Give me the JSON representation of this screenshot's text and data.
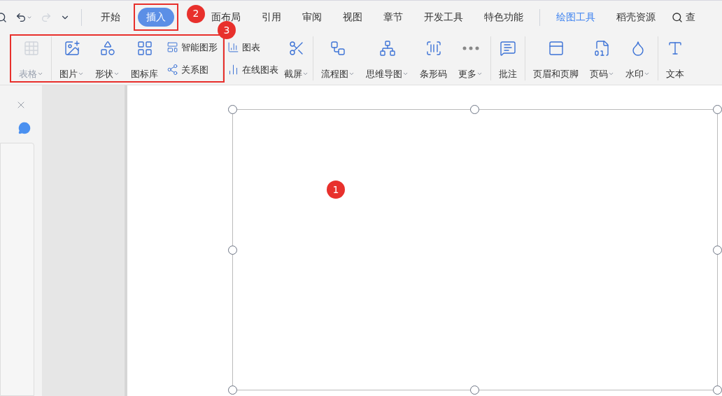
{
  "quick_access": [
    {
      "kind": "search",
      "disabled": false,
      "dropdown": false
    },
    {
      "kind": "undo",
      "disabled": false,
      "dropdown": true
    },
    {
      "kind": "redo",
      "disabled": true,
      "dropdown": false
    },
    {
      "kind": "customize",
      "disabled": false,
      "dropdown": false
    }
  ],
  "tabs": [
    {
      "label": "开始",
      "selected": false,
      "kind": "normal"
    },
    {
      "label": "插入",
      "selected": true,
      "kind": "normal"
    },
    {
      "label": "面布局",
      "selected": false,
      "kind": "normal"
    },
    {
      "label": "引用",
      "selected": false,
      "kind": "normal"
    },
    {
      "label": "审阅",
      "selected": false,
      "kind": "normal"
    },
    {
      "label": "视图",
      "selected": false,
      "kind": "normal"
    },
    {
      "label": "章节",
      "selected": false,
      "kind": "normal"
    },
    {
      "label": "开发工具",
      "selected": false,
      "kind": "normal"
    },
    {
      "label": "特色功能",
      "selected": false,
      "kind": "normal"
    },
    {
      "label": "绘图工具",
      "selected": false,
      "kind": "context"
    },
    {
      "label": "稻壳资源",
      "selected": false,
      "kind": "normal"
    }
  ],
  "search": {
    "label": "查"
  },
  "toolbar_groups": [
    {
      "items": [
        {
          "kind": "large",
          "label": "表格",
          "disabled": true,
          "dropdown": true
        }
      ]
    },
    {
      "items": [
        {
          "kind": "large",
          "label": "图片",
          "disabled": false,
          "dropdown": true
        },
        {
          "kind": "large",
          "label": "形状",
          "disabled": false,
          "dropdown": true
        },
        {
          "kind": "large",
          "label": "图标库",
          "disabled": false,
          "dropdown": false
        },
        {
          "kind": "stack",
          "entries": [
            {
              "label": "智能图形"
            },
            {
              "label": "关系图"
            }
          ]
        },
        {
          "kind": "stack",
          "entries": [
            {
              "label": "图表"
            },
            {
              "label": "在线图表"
            }
          ]
        },
        {
          "kind": "large",
          "label": "截屏",
          "disabled": false,
          "dropdown": true
        }
      ]
    },
    {
      "items": [
        {
          "kind": "large",
          "label": "流程图",
          "disabled": false,
          "dropdown": true
        },
        {
          "kind": "large",
          "label": "思维导图",
          "disabled": false,
          "dropdown": true
        },
        {
          "kind": "large",
          "label": "条形码",
          "disabled": false,
          "dropdown": false
        },
        {
          "kind": "large",
          "label": "更多",
          "disabled": false,
          "dropdown": true
        }
      ]
    },
    {
      "items": [
        {
          "kind": "large",
          "label": "批注",
          "disabled": false,
          "dropdown": false
        }
      ]
    },
    {
      "items": [
        {
          "kind": "large",
          "label": "页眉和页脚",
          "disabled": false,
          "dropdown": false
        },
        {
          "kind": "large",
          "label": "页码",
          "disabled": false,
          "dropdown": true
        },
        {
          "kind": "large",
          "label": "水印",
          "disabled": false,
          "dropdown": true
        }
      ]
    },
    {
      "items": [
        {
          "kind": "large",
          "label": "文本",
          "disabled": false,
          "dropdown": false
        }
      ]
    }
  ],
  "text_box": {
    "selected": true
  },
  "annotations": [
    {
      "kind": "box"
    },
    {
      "kind": "box"
    },
    {
      "kind": "badge",
      "label": "1"
    },
    {
      "kind": "badge",
      "label": "2"
    },
    {
      "kind": "badge",
      "label": "3"
    }
  ]
}
